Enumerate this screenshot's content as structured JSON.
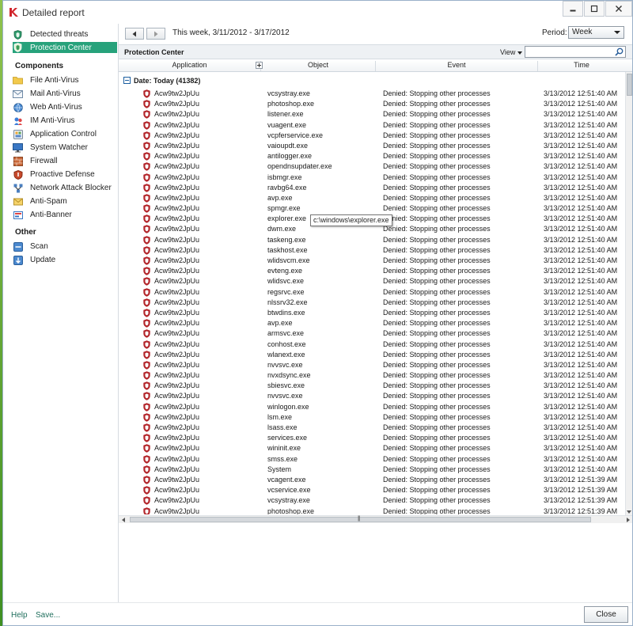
{
  "window": {
    "title": "Detailed report"
  },
  "sidebar": {
    "top_items": [
      {
        "label": "Detected threats",
        "icon": "shield-icon"
      },
      {
        "label": "Protection Center",
        "icon": "shield-icon",
        "active": true
      }
    ],
    "components_heading": "Components",
    "components": [
      {
        "label": "File Anti-Virus",
        "icon": "folder-icon"
      },
      {
        "label": "Mail Anti-Virus",
        "icon": "mail-icon"
      },
      {
        "label": "Web Anti-Virus",
        "icon": "globe-icon"
      },
      {
        "label": "IM Anti-Virus",
        "icon": "im-icon"
      },
      {
        "label": "Application Control",
        "icon": "app-control-icon"
      },
      {
        "label": "System Watcher",
        "icon": "monitor-icon"
      },
      {
        "label": "Firewall",
        "icon": "firewall-icon"
      },
      {
        "label": "Proactive Defense",
        "icon": "proactive-icon"
      },
      {
        "label": "Network Attack Blocker",
        "icon": "network-icon"
      },
      {
        "label": "Anti-Spam",
        "icon": "anti-spam-icon"
      },
      {
        "label": "Anti-Banner",
        "icon": "anti-banner-icon"
      }
    ],
    "other_heading": "Other",
    "other": [
      {
        "label": "Scan",
        "icon": "scan-icon"
      },
      {
        "label": "Update",
        "icon": "update-icon"
      }
    ]
  },
  "toolbar": {
    "date_range": "This week, 3/11/2012 - 3/17/2012",
    "period_label": "Period:",
    "period_value": "Week"
  },
  "section": {
    "title": "Protection Center",
    "view_label": "View"
  },
  "table": {
    "columns": [
      "Application",
      "Object",
      "Event",
      "Time"
    ],
    "group_label": "Date: Today (41382)",
    "rows": [
      [
        "Acw9tw2JpUu",
        "vcsystray.exe",
        "Denied: Stopping other processes",
        "3/13/2012 12:51:40 AM"
      ],
      [
        "Acw9tw2JpUu",
        "photoshop.exe",
        "Denied: Stopping other processes",
        "3/13/2012 12:51:40 AM"
      ],
      [
        "Acw9tw2JpUu",
        "listener.exe",
        "Denied: Stopping other processes",
        "3/13/2012 12:51:40 AM"
      ],
      [
        "Acw9tw2JpUu",
        "vuagent.exe",
        "Denied: Stopping other processes",
        "3/13/2012 12:51:40 AM"
      ],
      [
        "Acw9tw2JpUu",
        "vcpferservice.exe",
        "Denied: Stopping other processes",
        "3/13/2012 12:51:40 AM"
      ],
      [
        "Acw9tw2JpUu",
        "vaioupdt.exe",
        "Denied: Stopping other processes",
        "3/13/2012 12:51:40 AM"
      ],
      [
        "Acw9tw2JpUu",
        "antilogger.exe",
        "Denied: Stopping other processes",
        "3/13/2012 12:51:40 AM"
      ],
      [
        "Acw9tw2JpUu",
        "opendnsupdater.exe",
        "Denied: Stopping other processes",
        "3/13/2012 12:51:40 AM"
      ],
      [
        "Acw9tw2JpUu",
        "isbmgr.exe",
        "Denied: Stopping other processes",
        "3/13/2012 12:51:40 AM"
      ],
      [
        "Acw9tw2JpUu",
        "ravbg64.exe",
        "Denied: Stopping other processes",
        "3/13/2012 12:51:40 AM"
      ],
      [
        "Acw9tw2JpUu",
        "avp.exe",
        "Denied: Stopping other processes",
        "3/13/2012 12:51:40 AM"
      ],
      [
        "Acw9tw2JpUu",
        "spmgr.exe",
        "Denied: Stopping other processes",
        "3/13/2012 12:51:40 AM"
      ],
      [
        "Acw9tw2JpUu",
        "explorer.exe",
        "Denied: Stopping other processes",
        "3/13/2012 12:51:40 AM"
      ],
      [
        "Acw9tw2JpUu",
        "dwm.exe",
        "Denied: Stopping other processes",
        "3/13/2012 12:51:40 AM"
      ],
      [
        "Acw9tw2JpUu",
        "taskeng.exe",
        "Denied: Stopping other processes",
        "3/13/2012 12:51:40 AM"
      ],
      [
        "Acw9tw2JpUu",
        "taskhost.exe",
        "Denied: Stopping other processes",
        "3/13/2012 12:51:40 AM"
      ],
      [
        "Acw9tw2JpUu",
        "wlidsvcm.exe",
        "Denied: Stopping other processes",
        "3/13/2012 12:51:40 AM"
      ],
      [
        "Acw9tw2JpUu",
        "evteng.exe",
        "Denied: Stopping other processes",
        "3/13/2012 12:51:40 AM"
      ],
      [
        "Acw9tw2JpUu",
        "wlidsvc.exe",
        "Denied: Stopping other processes",
        "3/13/2012 12:51:40 AM"
      ],
      [
        "Acw9tw2JpUu",
        "regsrvc.exe",
        "Denied: Stopping other processes",
        "3/13/2012 12:51:40 AM"
      ],
      [
        "Acw9tw2JpUu",
        "nlssrv32.exe",
        "Denied: Stopping other processes",
        "3/13/2012 12:51:40 AM"
      ],
      [
        "Acw9tw2JpUu",
        "btwdins.exe",
        "Denied: Stopping other processes",
        "3/13/2012 12:51:40 AM"
      ],
      [
        "Acw9tw2JpUu",
        "avp.exe",
        "Denied: Stopping other processes",
        "3/13/2012 12:51:40 AM"
      ],
      [
        "Acw9tw2JpUu",
        "armsvc.exe",
        "Denied: Stopping other processes",
        "3/13/2012 12:51:40 AM"
      ],
      [
        "Acw9tw2JpUu",
        "conhost.exe",
        "Denied: Stopping other processes",
        "3/13/2012 12:51:40 AM"
      ],
      [
        "Acw9tw2JpUu",
        "wlanext.exe",
        "Denied: Stopping other processes",
        "3/13/2012 12:51:40 AM"
      ],
      [
        "Acw9tw2JpUu",
        "nvvsvc.exe",
        "Denied: Stopping other processes",
        "3/13/2012 12:51:40 AM"
      ],
      [
        "Acw9tw2JpUu",
        "nvxdsync.exe",
        "Denied: Stopping other processes",
        "3/13/2012 12:51:40 AM"
      ],
      [
        "Acw9tw2JpUu",
        "sbiesvc.exe",
        "Denied: Stopping other processes",
        "3/13/2012 12:51:40 AM"
      ],
      [
        "Acw9tw2JpUu",
        "nvvsvc.exe",
        "Denied: Stopping other processes",
        "3/13/2012 12:51:40 AM"
      ],
      [
        "Acw9tw2JpUu",
        "winlogon.exe",
        "Denied: Stopping other processes",
        "3/13/2012 12:51:40 AM"
      ],
      [
        "Acw9tw2JpUu",
        "lsm.exe",
        "Denied: Stopping other processes",
        "3/13/2012 12:51:40 AM"
      ],
      [
        "Acw9tw2JpUu",
        "lsass.exe",
        "Denied: Stopping other processes",
        "3/13/2012 12:51:40 AM"
      ],
      [
        "Acw9tw2JpUu",
        "services.exe",
        "Denied: Stopping other processes",
        "3/13/2012 12:51:40 AM"
      ],
      [
        "Acw9tw2JpUu",
        "wininit.exe",
        "Denied: Stopping other processes",
        "3/13/2012 12:51:40 AM"
      ],
      [
        "Acw9tw2JpUu",
        "smss.exe",
        "Denied: Stopping other processes",
        "3/13/2012 12:51:40 AM"
      ],
      [
        "Acw9tw2JpUu",
        "System",
        "Denied: Stopping other processes",
        "3/13/2012 12:51:40 AM"
      ],
      [
        "Acw9tw2JpUu",
        "vcagent.exe",
        "Denied: Stopping other processes",
        "3/13/2012 12:51:39 AM"
      ],
      [
        "Acw9tw2JpUu",
        "vcservice.exe",
        "Denied: Stopping other processes",
        "3/13/2012 12:51:39 AM"
      ],
      [
        "Acw9tw2JpUu",
        "vcsystray.exe",
        "Denied: Stopping other processes",
        "3/13/2012 12:51:39 AM"
      ],
      [
        "Acw9tw2JpUu",
        "photoshop.exe",
        "Denied: Stopping other processes",
        "3/13/2012 12:51:39 AM"
      ]
    ]
  },
  "tooltip": "c:\\windows\\explorer.exe",
  "footer": {
    "help": "Help",
    "save": "Save...",
    "close": "Close"
  },
  "colors": {
    "accent": "#27a27b",
    "threat_red": "#b3262b",
    "link": "#1f6e5c"
  }
}
